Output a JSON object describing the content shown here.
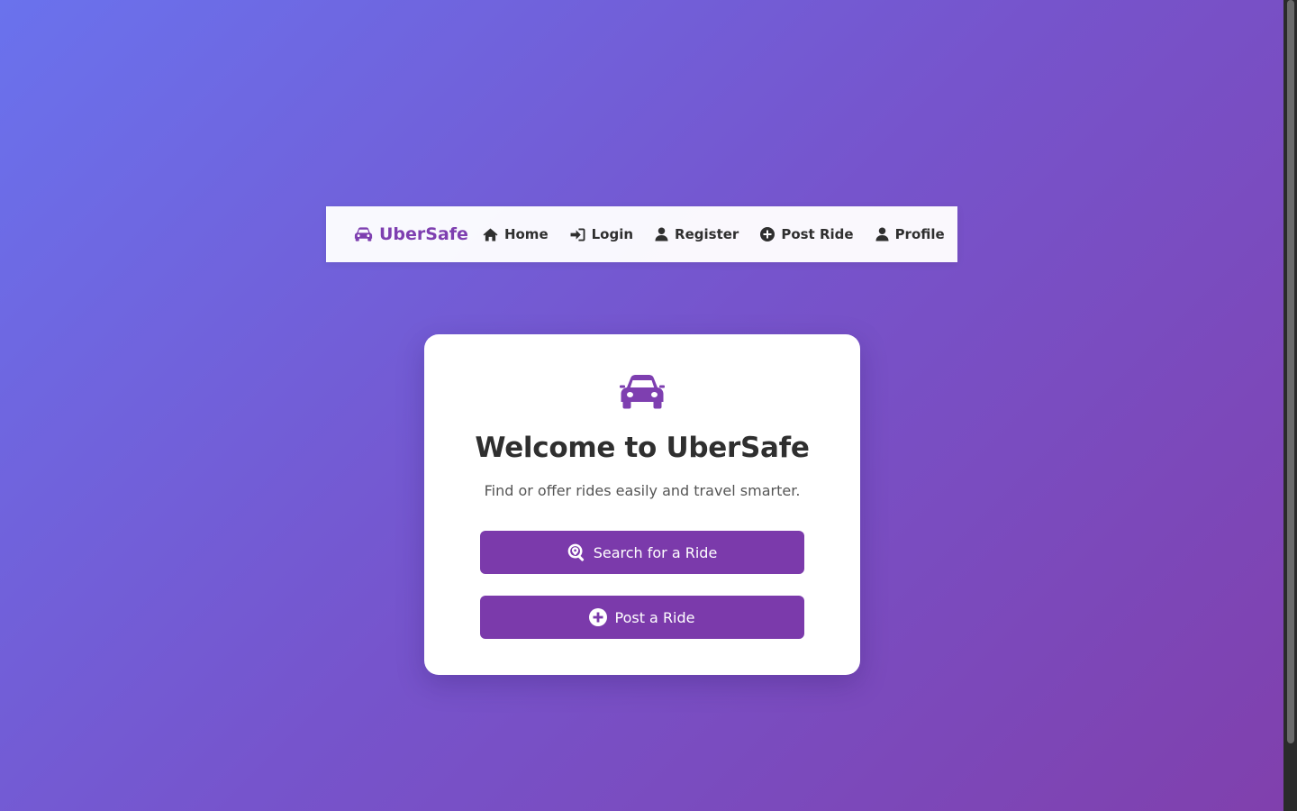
{
  "navbar": {
    "brand": "UberSafe",
    "items": [
      {
        "label": "Home",
        "icon": "home-icon"
      },
      {
        "label": "Login",
        "icon": "sign-in-icon"
      },
      {
        "label": "Register",
        "icon": "user-icon"
      },
      {
        "label": "Post Ride",
        "icon": "plus-circle-icon"
      },
      {
        "label": "Profile",
        "icon": "user-icon"
      }
    ]
  },
  "hero": {
    "icon": "car-icon",
    "title": "Welcome to UberSafe",
    "subtitle": "Find or offer rides easily and travel smarter.",
    "buttons": [
      {
        "label": "Search for a Ride",
        "icon": "search-location-icon"
      },
      {
        "label": "Post a Ride",
        "icon": "plus-circle-icon"
      }
    ]
  },
  "colors": {
    "brand": "#7e3fb0",
    "button": "#7b3aab",
    "background_start": "#6a72ed",
    "background_end": "#8040ad"
  }
}
